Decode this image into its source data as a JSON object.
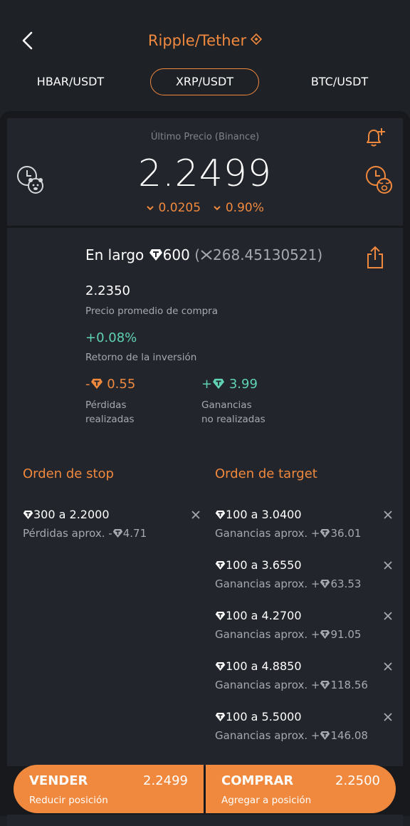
{
  "header": {
    "title": "Ripple/Tether",
    "pairs": [
      "HBAR/USDT",
      "XRP/USDT",
      "BTC/USDT"
    ],
    "active_pair": "XRP/USDT"
  },
  "price": {
    "label": "Último Precio (Binance)",
    "value": "2.2499",
    "change_abs": "0.0205",
    "change_pct": "0.90%"
  },
  "position": {
    "side": "En largo",
    "amount": "600",
    "amount_alt": "268.45130521",
    "avg_price": "2.2350",
    "avg_price_label": "Precio promedio de compra",
    "roi": "+0.08%",
    "roi_label": "Retorno de la inversión",
    "realized_sign": "-",
    "realized_value": "0.55",
    "realized_label_1": "Pérdidas",
    "realized_label_2": "realizadas",
    "unrealized_sign": "+",
    "unrealized_value": "3.99",
    "unrealized_label_1": "Ganancias",
    "unrealized_label_2": "no realizadas"
  },
  "stop": {
    "title": "Orden de stop",
    "orders": [
      {
        "line1": "300 a 2.2000",
        "prefix": "Pérdidas aprox. -",
        "value": "4.71"
      }
    ]
  },
  "target": {
    "title": "Orden de target",
    "orders": [
      {
        "line1": "100 a 3.0400",
        "prefix": "Ganancias aprox. +",
        "value": "36.01"
      },
      {
        "line1": "100 a 3.6550",
        "prefix": "Ganancias aprox. +",
        "value": "63.53"
      },
      {
        "line1": "100 a 4.2700",
        "prefix": "Ganancias aprox. +",
        "value": "91.05"
      },
      {
        "line1": "100 a 4.8850",
        "prefix": "Ganancias aprox. +",
        "value": "118.56"
      },
      {
        "line1": "100 a 5.5000",
        "prefix": "Ganancias aprox. +",
        "value": "146.08"
      }
    ]
  },
  "actions": {
    "sell_label": "VENDER",
    "sell_price": "2.2499",
    "sell_sub": "Reducir posición",
    "buy_label": "COMPRAR",
    "buy_price": "2.2500",
    "buy_sub": "Agregar a posición"
  },
  "colors": {
    "accent": "#f0893e",
    "positive": "#5fd3b3",
    "background": "#1e2126"
  }
}
